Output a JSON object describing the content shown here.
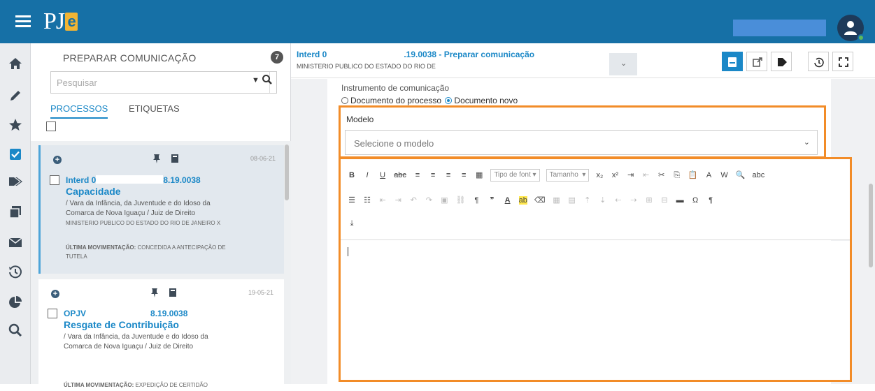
{
  "app": {
    "logo_text": "PJ",
    "logo_e": "e"
  },
  "header": {
    "user_name": ""
  },
  "left_nav": {
    "items": [
      "home-icon",
      "pencil-icon",
      "star-icon",
      "checkbox-icon",
      "tags-icon",
      "documents-icon",
      "envelope-icon",
      "history-icon",
      "pie-chart-icon",
      "search-icon"
    ]
  },
  "list_panel": {
    "title": "PREPARAR COMUNICAÇÃO",
    "count": "7",
    "search_placeholder": "Pesquisar",
    "tabs": [
      "PROCESSOS",
      "ETIQUETAS"
    ],
    "cards": [
      {
        "date": "08-06-21",
        "number_start": "Interd 0",
        "number_end": "8.19.0038",
        "class": "Capacidade",
        "line1": "/ Vara da Infância, da Juventude e do Idoso da",
        "line2": "Comarca de Nova Iguaçu / Juiz de Direito",
        "line3": "MINISTERIO PUBLICO DO ESTADO DO RIO DE JANEIRO X",
        "last_label": "ÚLTIMA MOVIMENTAÇÃO:",
        "last_value": "CONCEDIDA A ANTECIPAÇÃO DE",
        "last_value2": "TUTELA"
      },
      {
        "date": "19-05-21",
        "number_start": "OPJV",
        "number_end": "8.19.0038",
        "class": "Resgate de Contribuição",
        "line1": "/ Vara da Infância, da Juventude e do Idoso da",
        "line2": "Comarca de Nova Iguaçu / Juiz de Direito",
        "line3": "",
        "last_label": "ÚLTIMA MOVIMENTAÇÃO:",
        "last_value": "EXPEDIÇÃO DE CERTIDÃO",
        "last_value2": ""
      }
    ]
  },
  "main": {
    "title_start": "Interd 0",
    "title_end": ".19.0038 - Preparar comunicação",
    "subtitle": "MINISTERIO PUBLICO DO ESTADO DO RIO DE",
    "instrument_label": "Instrumento de comunicação",
    "radio_options": [
      "Documento do processo",
      "Documento novo"
    ],
    "selected_radio": "Documento novo",
    "model_label": "Modelo",
    "model_value": "Selecione o modelo",
    "editor": {
      "font_dropdown": "Tipo de font",
      "size_dropdown": "Tamanho",
      "content": ""
    }
  },
  "colors": {
    "topbar": "#1670a6",
    "accent": "#1b88c7",
    "highlight_border": "#f28c28"
  }
}
